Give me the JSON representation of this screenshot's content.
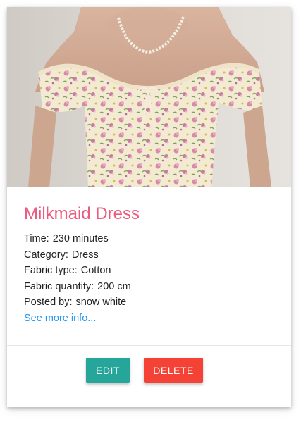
{
  "card": {
    "title": "Milkmaid Dress",
    "details": [
      {
        "label": "Time:",
        "value": "230 minutes"
      },
      {
        "label": "Category:",
        "value": "Dress"
      },
      {
        "label": "Fabric type:",
        "value": "Cotton"
      },
      {
        "label": "Fabric quantity:",
        "value": "200 cm"
      },
      {
        "label": "Posted by:",
        "value": "snow white"
      }
    ],
    "more_link": "See more info...",
    "image_subject": "floral-off-shoulder-dress-photo"
  },
  "actions": {
    "edit_label": "EDIT",
    "delete_label": "DELETE"
  },
  "colors": {
    "title": "#ec5b7f",
    "link": "#2196f3",
    "edit_button": "#26a69a",
    "delete_button": "#f44336"
  }
}
